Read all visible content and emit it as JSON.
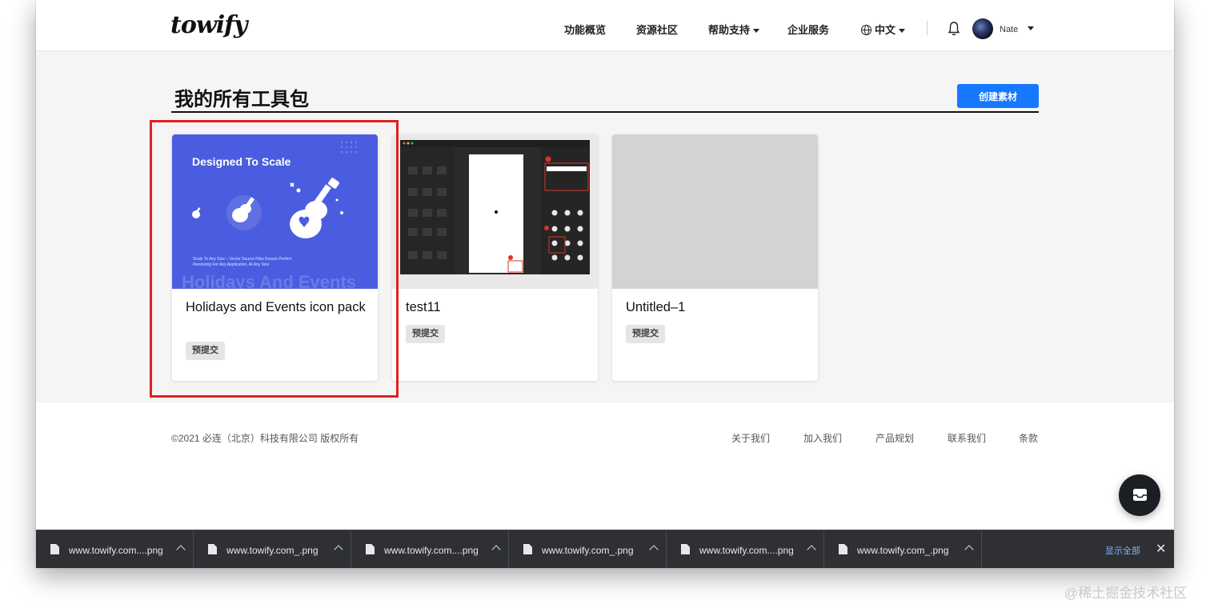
{
  "header": {
    "logo": "towify",
    "nav": [
      "功能概览",
      "资源社区",
      "帮助支持",
      "企业服务",
      "中文"
    ],
    "user_name": "Nate"
  },
  "main": {
    "title": "我的所有工具包",
    "create_button": "创建素材",
    "cards": [
      {
        "title": "Holidays and Events icon pack",
        "badge": "预提交",
        "thumb_title": "Designed To Scale",
        "thumb_sub": "Scale To Any Size – Vector Source Files Ensure Perfect Rendering For Any Application, At Any Size",
        "thumb_watermark": "Holidays And Events"
      },
      {
        "title": "test11",
        "badge": "预提交"
      },
      {
        "title": "Untitled–1",
        "badge": "预提交"
      }
    ]
  },
  "footer": {
    "copyright": "©2021 必连（北京）科技有限公司 版权所有",
    "links": [
      "关于我们",
      "加入我们",
      "产品规划",
      "联系我们",
      "条款"
    ]
  },
  "downloads": {
    "items": [
      "www.towify.com....png",
      "www.towify.com_.png",
      "www.towify.com....png",
      "www.towify.com_.png",
      "www.towify.com....png",
      "www.towify.com_.png"
    ],
    "show_all": "显示全部",
    "close": "✕"
  },
  "watermark": "@稀土掘金技术社区",
  "colors": {
    "accent": "#1677ff",
    "selection": "#e02020",
    "card_blue": "#4a5de0"
  }
}
